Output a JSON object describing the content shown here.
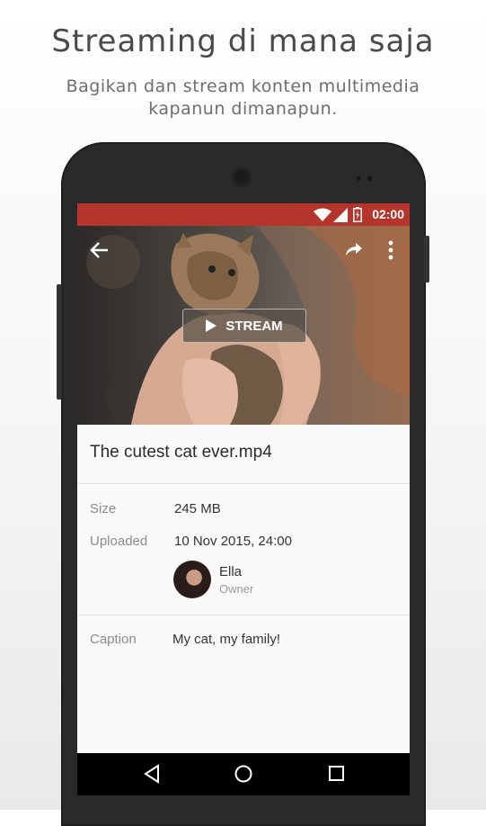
{
  "promo": {
    "headline": "Streaming di mana saja",
    "subline_1": "Bagikan dan stream konten multimedia",
    "subline_2": "kapanun dimanapun."
  },
  "status_bar": {
    "time": "02:00",
    "color": "#b5342b"
  },
  "hero": {
    "stream_label": "STREAM",
    "icons": [
      "arrow-back-icon",
      "share-icon",
      "more-vert-icon",
      "play-icon"
    ]
  },
  "file": {
    "title": "The cutest cat ever.mp4",
    "size_label": "Size",
    "size_value": "245 MB",
    "uploaded_label": "Uploaded",
    "uploaded_value": "10 Nov 2015, 24:00",
    "owner_name": "Ella",
    "owner_role": "Owner",
    "caption_label": "Caption",
    "caption_value": "My cat, my family!"
  },
  "nav_bar": {
    "icons": [
      "back-triangle-icon",
      "home-circle-icon",
      "recents-square-icon"
    ]
  }
}
